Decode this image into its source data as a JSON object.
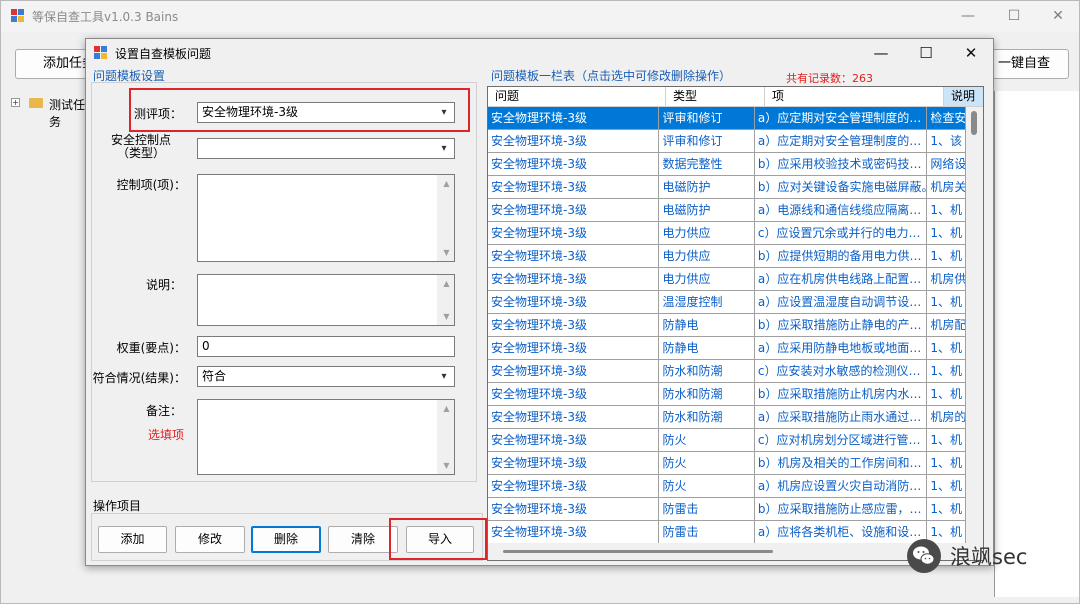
{
  "main_window": {
    "title": "等保自查工具v1.0.3 Bains",
    "add_task_label": "添加任务",
    "oneclick_label": "一键自查",
    "tree_item": "测试任务",
    "tree_expander": "+"
  },
  "dialog": {
    "title": "设置自查模板问题",
    "left_group_title": "问题模板设置",
    "right_group_title": "问题模板一栏表（点击选中可修改删除操作）",
    "record_count_label": "共有记录数：263",
    "fields": {
      "eval_item_label": "测评项：",
      "eval_item_value": "安全物理环境-3级",
      "control_point_label": "安全控制点（类型）",
      "control_item_label": "控制项(项)：",
      "description_label": "说明：",
      "weight_label": "权重(要点)：",
      "weight_value": "0",
      "compliance_label": "符合情况(结果)：",
      "compliance_value": "符合",
      "remark_label": "备注：",
      "optional_label": "选填项"
    },
    "ops_group_title": "操作项目",
    "buttons": {
      "add": "添加",
      "modify": "修改",
      "delete": "删除",
      "clear": "清除",
      "import": "导入"
    },
    "grid": {
      "columns": [
        "问题",
        "类型",
        "项",
        "说明"
      ],
      "rows": [
        [
          "安全物理环境-3级",
          "评审和修订",
          "a）应定期对安全管理制度的…",
          "检查安"
        ],
        [
          "安全物理环境-3级",
          "评审和修订",
          "a）应定期对安全管理制度的…",
          "1、该"
        ],
        [
          "安全物理环境-3级",
          "数据完整性",
          "b）应采用校验技术或密码技…",
          "网络设"
        ],
        [
          "安全物理环境-3级",
          "电磁防护",
          "b）应对关键设备实施电磁屏蔽。",
          "机房关"
        ],
        [
          "安全物理环境-3级",
          "电磁防护",
          "a）电源线和通信线缆应隔离…",
          "1、机"
        ],
        [
          "安全物理环境-3级",
          "电力供应",
          "c）应设置冗余或并行的电力…",
          "1、机"
        ],
        [
          "安全物理环境-3级",
          "电力供应",
          "b）应提供短期的备用电力供…",
          "1、机"
        ],
        [
          "安全物理环境-3级",
          "电力供应",
          "a）应在机房供电线路上配置…",
          "机房供"
        ],
        [
          "安全物理环境-3级",
          "温湿度控制",
          "a）应设置温湿度自动调节设…",
          "1、机"
        ],
        [
          "安全物理环境-3级",
          "防静电",
          "b）应采取措施防止静电的产…",
          "机房配"
        ],
        [
          "安全物理环境-3级",
          "防静电",
          "a）应采用防静电地板或地面…",
          "1、机"
        ],
        [
          "安全物理环境-3级",
          "防水和防潮",
          "c）应安装对水敏感的检测仪…",
          "1、机"
        ],
        [
          "安全物理环境-3级",
          "防水和防潮",
          "b）应采取措施防止机房内水…",
          "1、机"
        ],
        [
          "安全物理环境-3级",
          "防水和防潮",
          "a）应采取措施防止雨水通过…",
          "机房的"
        ],
        [
          "安全物理环境-3级",
          "防火",
          "c）应对机房划分区域进行管…",
          "1、机"
        ],
        [
          "安全物理环境-3级",
          "防火",
          "b）机房及相关的工作房间和…",
          "1、机"
        ],
        [
          "安全物理环境-3级",
          "防火",
          "a）机房应设置火灾自动消防…",
          "1、机"
        ],
        [
          "安全物理环境-3级",
          "防雷击",
          "b）应采取措施防止感应雷，…",
          "1、机"
        ],
        [
          "安全物理环境-3级",
          "防雷击",
          "a）应将各类机柜、设施和设…",
          "1、机"
        ]
      ]
    }
  },
  "watermark": {
    "text": "浪飒sec"
  },
  "colors": {
    "accent": "#0078d7",
    "highlight_box": "#e0242a",
    "link_text": "#0b5fc7",
    "count_text": "#e02020"
  }
}
